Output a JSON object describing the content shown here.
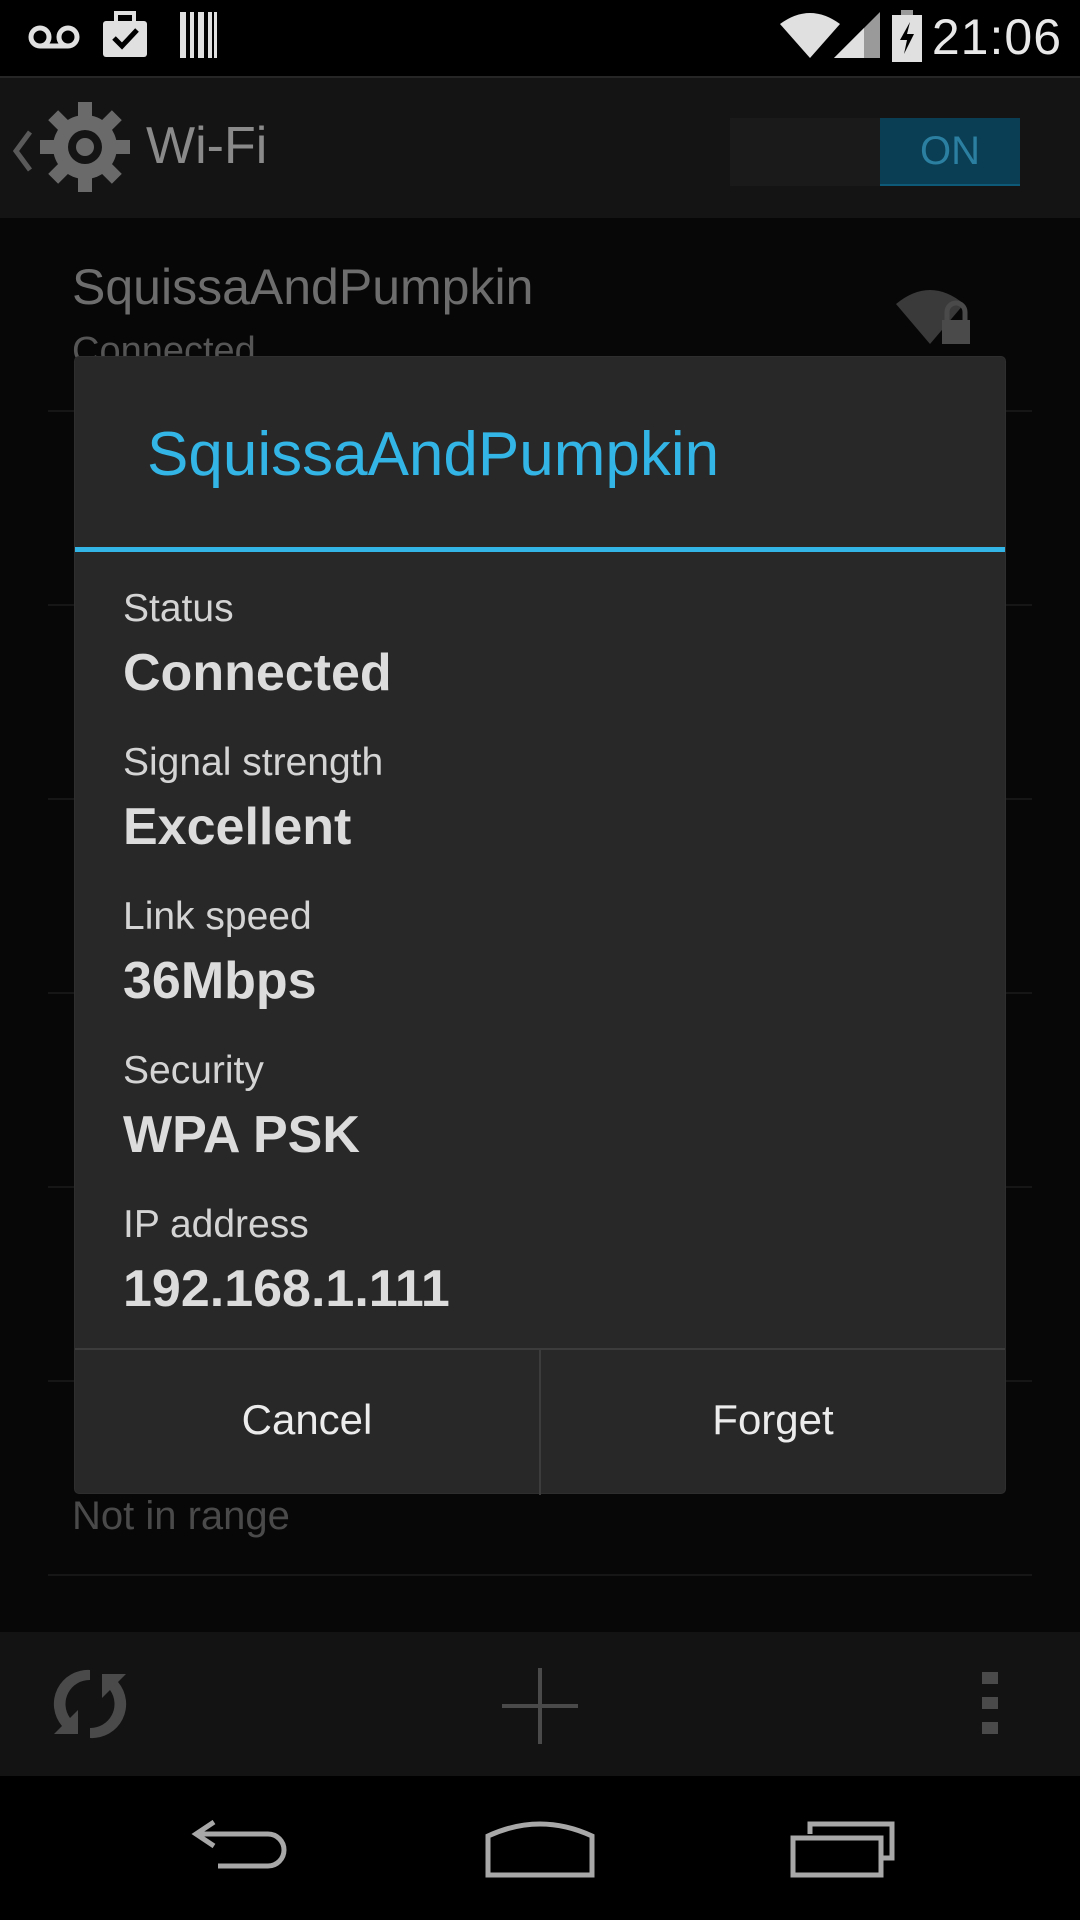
{
  "status_bar": {
    "time": "21:06",
    "icons": [
      "voicemail-icon",
      "task-check-icon",
      "barcode-icon",
      "wifi-signal-icon",
      "cell-signal-icon",
      "battery-charging-icon"
    ]
  },
  "action_bar": {
    "title": "Wi-Fi",
    "toggle_label": "ON",
    "icons": [
      "back-caret-icon",
      "settings-gear-icon"
    ]
  },
  "background_list": {
    "network_name": "SquissaAndPumpkin",
    "network_status": "Connected",
    "lower_status": "Not in range"
  },
  "dialog": {
    "title": "SquissaAndPumpkin",
    "fields": [
      {
        "label": "Status",
        "value": "Connected"
      },
      {
        "label": "Signal strength",
        "value": "Excellent"
      },
      {
        "label": "Link speed",
        "value": "36Mbps"
      },
      {
        "label": "Security",
        "value": "WPA PSK"
      },
      {
        "label": "IP address",
        "value": "192.168.1.111"
      }
    ],
    "cancel_label": "Cancel",
    "forget_label": "Forget"
  },
  "bottom_actions": {
    "icons": [
      "wps-icon",
      "add-network-icon",
      "overflow-menu-icon"
    ]
  },
  "nav_bar": {
    "icons": [
      "back-icon",
      "home-icon",
      "recents-icon"
    ]
  },
  "colors": {
    "accent": "#33b5e5",
    "dialog_bg": "#282828",
    "toggle_on": "#0a3e54"
  }
}
